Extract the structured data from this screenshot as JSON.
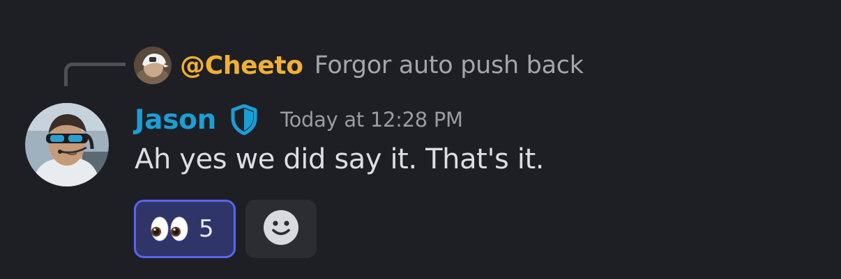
{
  "reply": {
    "author": "@Cheeto",
    "text": "Forgor auto push back",
    "author_color": "#f0b132"
  },
  "message": {
    "author": "Jason",
    "author_color": "#1a9ed6",
    "badge_icon": "shield-icon",
    "timestamp": "Today at 12:28 PM",
    "content": "Ah yes we did say it. That's it."
  },
  "reactions": [
    {
      "emoji": "eyes",
      "count": "5",
      "active": true
    }
  ],
  "add_reaction_icon": "smiley-face-icon",
  "colors": {
    "background": "#1e1f24",
    "reaction_active_bg": "#2f3569",
    "reaction_active_border": "#5865f2"
  }
}
